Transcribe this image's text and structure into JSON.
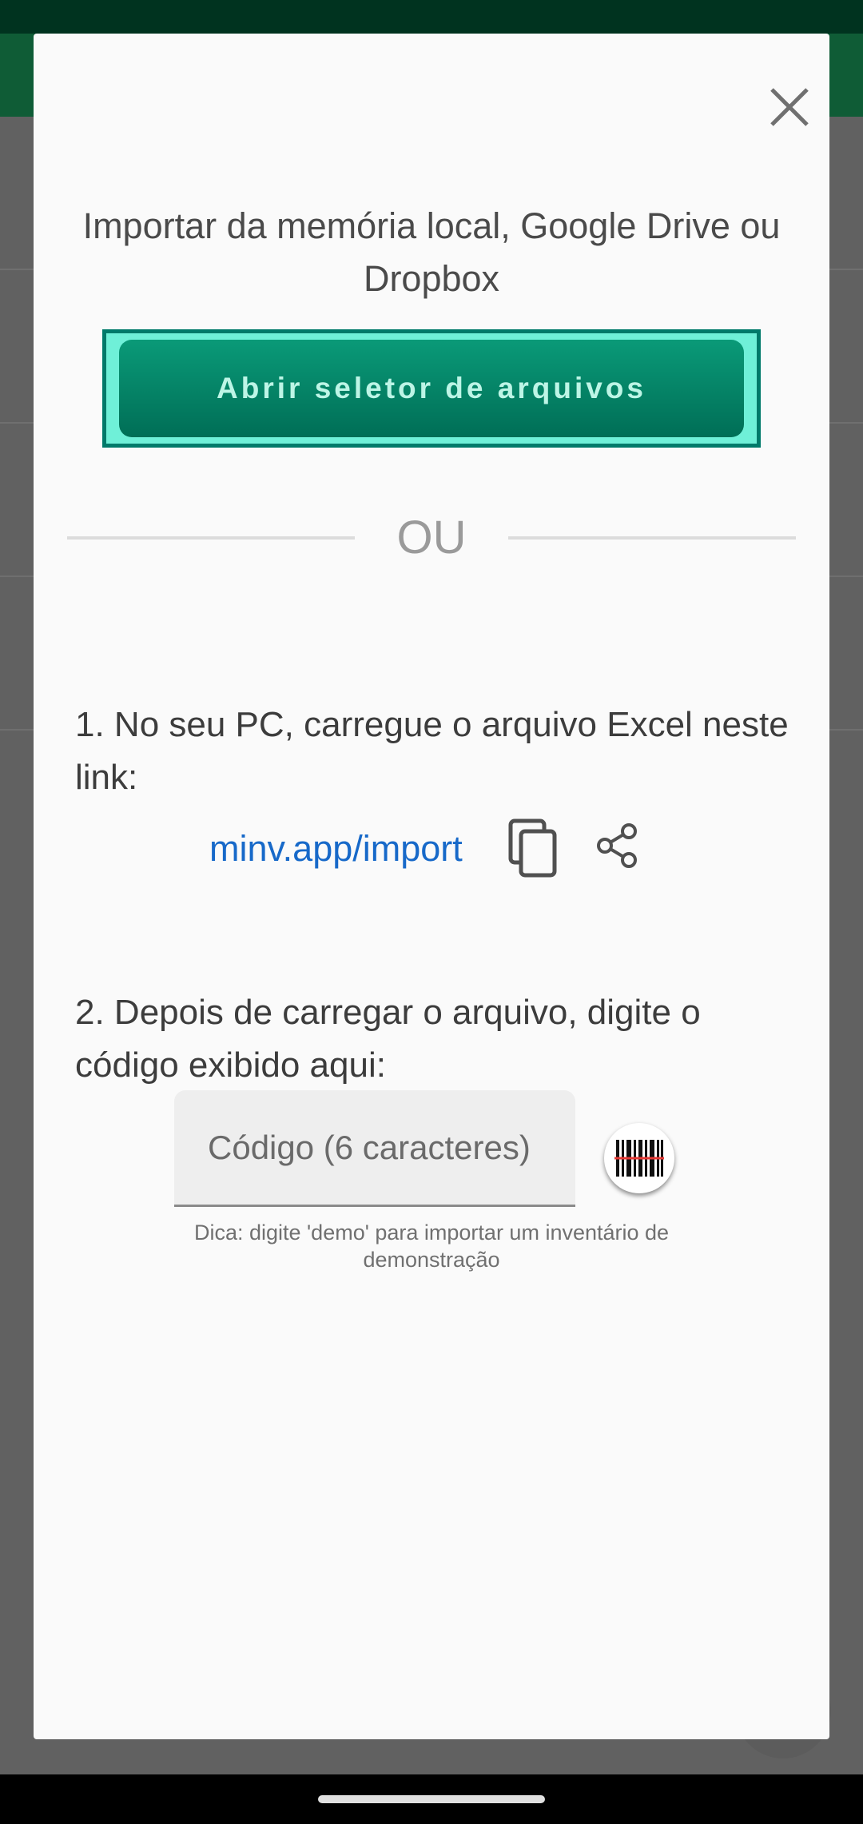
{
  "dialog": {
    "close_icon": "close-icon",
    "title": "Importar da memória local, Google Drive ou Dropbox",
    "open_picker_label": "Abrir seletor de arquivos",
    "or_label": "OU",
    "step1": "1. No seu PC, carregue o arquivo Excel neste link:",
    "link_text": "minv.app/import",
    "copy_icon": "copy-icon",
    "share_icon": "share-icon",
    "step2": "2. Depois de carregar o arquivo, digite o código exibido aqui:",
    "code_placeholder": "Código (6 caracteres)",
    "code_value": "",
    "scan_icon": "barcode-scan-icon",
    "hint": "Dica: digite 'demo' para importar um inventário de demonstração"
  },
  "colors": {
    "accent": "#007a6a",
    "link": "#1769c9",
    "app_bar": "#0f5c36"
  }
}
